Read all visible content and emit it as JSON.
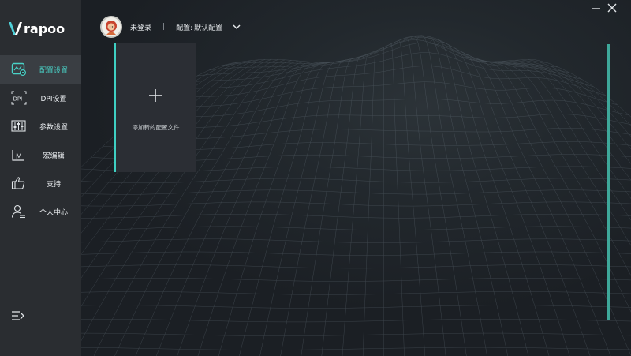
{
  "brand": {
    "logo_text": "rapoo",
    "accent_color": "#49d2c7"
  },
  "sidebar": {
    "items": [
      {
        "label": "配置设置",
        "icon": "profile-settings-icon",
        "active": true
      },
      {
        "label": "DPI设置",
        "icon": "dpi-icon",
        "active": false
      },
      {
        "label": "参数设置",
        "icon": "sliders-icon",
        "active": false
      },
      {
        "label": "宏编辑",
        "icon": "macro-icon",
        "active": false
      },
      {
        "label": "支持",
        "icon": "thumbs-up-icon",
        "active": false
      },
      {
        "label": "个人中心",
        "icon": "user-center-icon",
        "active": false
      }
    ],
    "collapse_icon": "collapse-menu-icon"
  },
  "header": {
    "user_name": "未登录",
    "divider": "|",
    "config_label": "配置:",
    "config_value": "默认配置",
    "dropdown_icon": "chevron-down-icon"
  },
  "window": {
    "minimize_icon": "minimize-icon",
    "close_icon": "close-icon"
  },
  "main": {
    "add_card": {
      "label": "添加新的配置文件",
      "icon": "plus-icon"
    }
  }
}
